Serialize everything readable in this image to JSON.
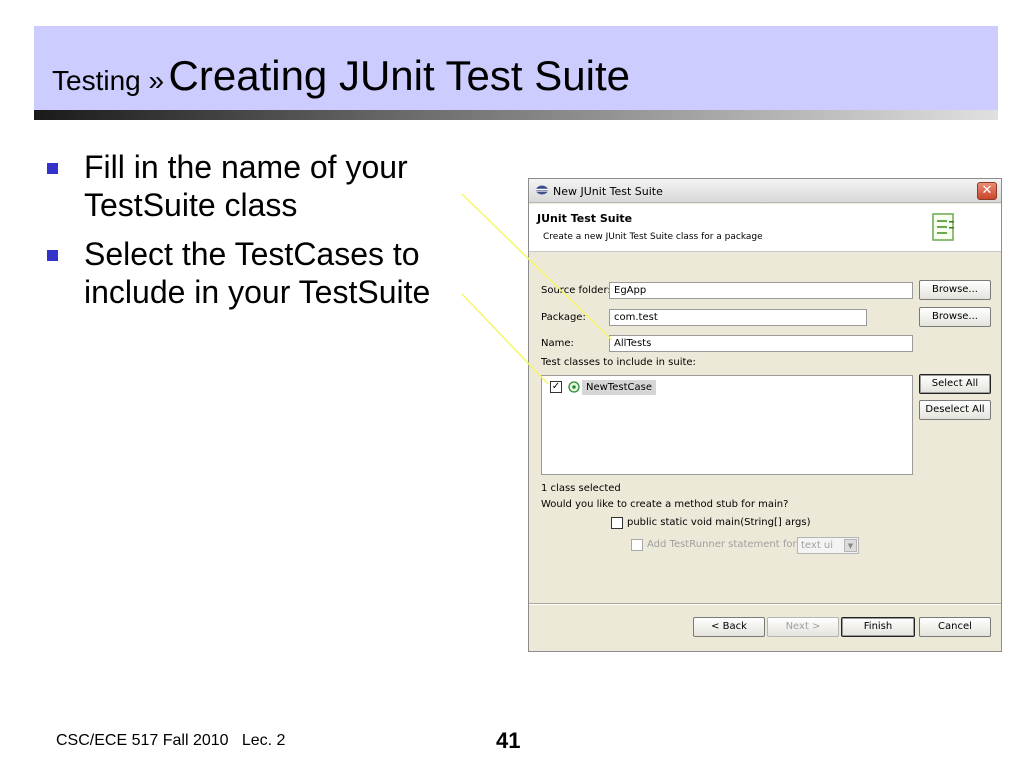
{
  "slide": {
    "title_prefix": "Testing »",
    "title_main": "Creating JUnit Test Suite",
    "bullets": [
      "Fill in the name of your TestSuite class",
      "Select the TestCases to include in your TestSuite"
    ],
    "footer_left": "CSC/ECE 517 Fall 2010   Lec. 2",
    "page_number": "41",
    "colors": {
      "title_bar": "#ccccff",
      "bullet": "#3333cc",
      "callout_line": "#f5f56a"
    }
  },
  "dialog": {
    "window_title": "New JUnit Test Suite",
    "close_glyph": "✕",
    "header_title": "JUnit Test Suite",
    "header_description": "Create a new JUnit Test Suite class for a package",
    "source_folder": {
      "label": "Source folder:",
      "value": "EgApp",
      "browse_label": "Browse..."
    },
    "package": {
      "label": "Package:",
      "value": "com.test",
      "browse_label": "Browse..."
    },
    "name": {
      "label": "Name:",
      "value": "AllTests"
    },
    "test_classes_label": "Test classes to include in suite:",
    "test_classes": [
      {
        "label": "NewTestCase",
        "checked": true
      }
    ],
    "select_all_label": "Select All",
    "deselect_all_label": "Deselect All",
    "selection_status": "1 class selected",
    "method_stub_question": "Would you like to create a method stub for main?",
    "main_stub_option": "public static void main(String[] args)",
    "testrunner_option": "Add TestRunner statement for:",
    "testrunner_value": "text ui",
    "check_glyph": "✓",
    "dropdown_glyph": "▼",
    "buttons": {
      "back": "< Back",
      "next": "Next >",
      "finish": "Finish",
      "cancel": "Cancel"
    }
  }
}
